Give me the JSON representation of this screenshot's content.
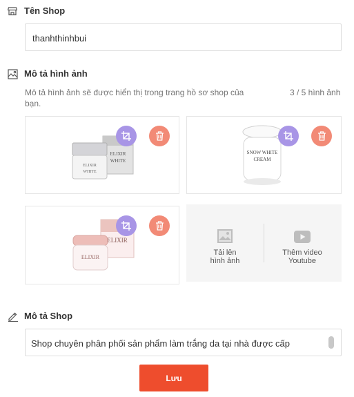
{
  "shop_name": {
    "label": "Tên Shop",
    "value": "thanhthinhbui"
  },
  "images": {
    "label": "Mô tả hình ảnh",
    "description": "Mô tả hình ảnh sẽ được hiển thị trong trang hồ sơ shop của bạn.",
    "count": "3 / 5 hình ảnh",
    "items": [
      {
        "brand": "ELIXIR",
        "sub": "WHITE",
        "cap": "#d4d4d8",
        "body": "#f2f2f2",
        "box": "#c7c7c7"
      },
      {
        "brand": "SNOW WHITE",
        "sub": "CREAM",
        "cap": "#f4f4f4",
        "body": "#ffffff",
        "box": ""
      },
      {
        "brand": "ELIXIR",
        "sub": "",
        "cap": "#e9b9b4",
        "body": "#f7eeee",
        "box": "#e9b9b4"
      }
    ],
    "upload_label": "Tải lên hình ảnh",
    "video_label": "Thêm video Youtube"
  },
  "description": {
    "label": "Mô tả Shop",
    "value": "Shop chuyên phân phối sản phẩm làm trắng da tại nhà được cấp"
  },
  "save_label": "Lưu",
  "colors": {
    "primary": "#ee4d2d",
    "crop_button": "#a895e6",
    "delete_button": "#f28a76"
  }
}
